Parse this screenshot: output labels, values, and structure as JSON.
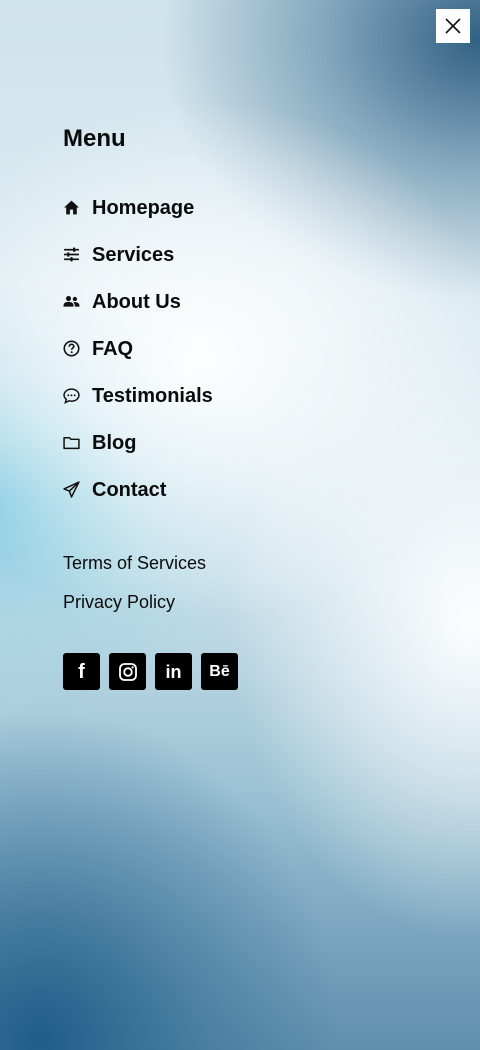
{
  "close": {
    "icon": "close-icon"
  },
  "menu": {
    "title": "Menu",
    "items": [
      {
        "label": "Homepage",
        "icon": "home-icon"
      },
      {
        "label": "Services",
        "icon": "sliders-icon"
      },
      {
        "label": "About Us",
        "icon": "users-icon"
      },
      {
        "label": "FAQ",
        "icon": "question-circle-icon"
      },
      {
        "label": "Testimonials",
        "icon": "chat-bubble-icon"
      },
      {
        "label": "Blog",
        "icon": "folder-icon"
      },
      {
        "label": "Contact",
        "icon": "paper-plane-icon"
      }
    ]
  },
  "links": {
    "terms": "Terms of Services",
    "privacy": "Privacy Policy"
  },
  "social": {
    "facebook": {
      "icon": "facebook-icon",
      "glyph": "f"
    },
    "instagram": {
      "icon": "instagram-icon"
    },
    "linkedin": {
      "icon": "linkedin-icon",
      "glyph": "in"
    },
    "behance": {
      "icon": "behance-icon",
      "glyph": "Bē"
    }
  },
  "colors": {
    "text": "#0b0b0b",
    "social_bg": "#000000",
    "close_bg": "#ffffff"
  }
}
